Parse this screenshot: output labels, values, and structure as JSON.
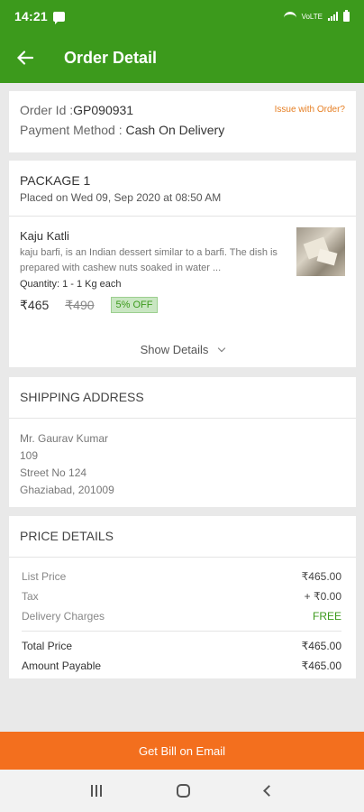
{
  "status_bar": {
    "time": "14:21",
    "network": "VoLTE"
  },
  "app_bar": {
    "title": "Order Detail"
  },
  "order": {
    "id_label": "Order Id :",
    "id_value": "GP090931",
    "issue_link": "Issue with Order?",
    "payment_label": "Payment Method :",
    "payment_value": "Cash On Delivery"
  },
  "package": {
    "title": "PACKAGE 1",
    "placed": "Placed on Wed 09, Sep 2020 at 08:50 AM",
    "item": {
      "name": "Kaju Katli",
      "description": "kaju barfi, is an Indian dessert similar to a barfi. The dish is prepared with cashew nuts soaked in water ...",
      "quantity": "Quantity: 1 - 1 Kg each",
      "price": "₹465",
      "mrp": "₹490",
      "discount": "5% OFF",
      "image_icon": "kaju-katli-photo"
    },
    "show_details": "Show Details"
  },
  "shipping": {
    "title": "SHIPPING ADDRESS",
    "lines": [
      "Mr. Gaurav Kumar",
      "109",
      "Street No 124",
      "Ghaziabad, 201009"
    ]
  },
  "price_details": {
    "title": "PRICE DETAILS",
    "list_price_label": "List Price",
    "list_price": "₹465.00",
    "tax_label": "Tax",
    "tax": "+ ₹0.00",
    "delivery_label": "Delivery Charges",
    "delivery": "FREE",
    "total_label": "Total Price",
    "total": "₹465.00",
    "payable_label": "Amount Payable",
    "payable": "₹465.00"
  },
  "cta": {
    "label": "Get Bill on Email"
  },
  "colors": {
    "brand_green": "#3c9a1c",
    "cta_orange": "#f36f1e",
    "issue_orange": "#e67e22"
  }
}
